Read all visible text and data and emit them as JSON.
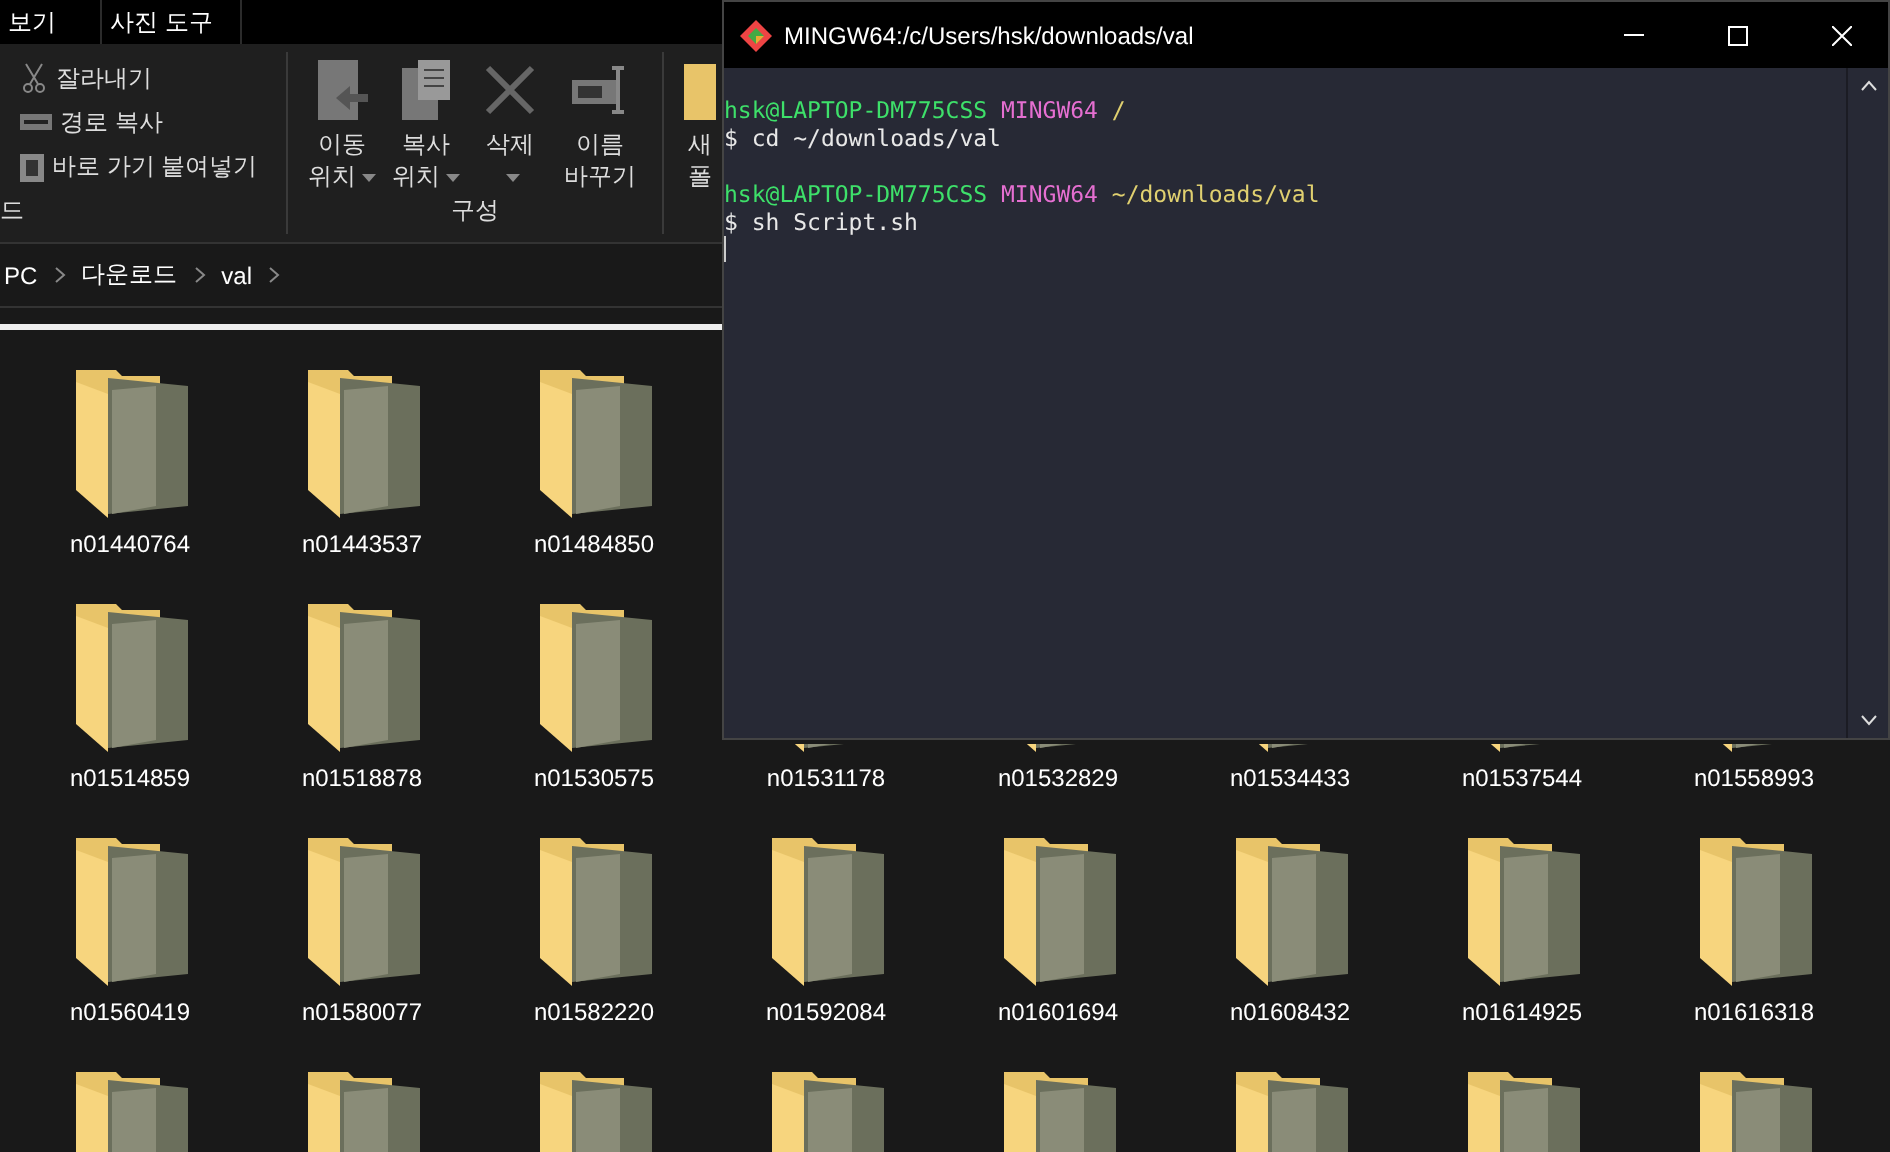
{
  "ribbon_tabs": [
    {
      "label": "보기",
      "selected": false
    },
    {
      "label": "사진 도구",
      "selected": false
    }
  ],
  "ribbon": {
    "clipboard_items": [
      {
        "label": "잘라내기",
        "kind": "cut"
      },
      {
        "label": "경로 복사",
        "kind": "path"
      },
      {
        "label": "바로 가기 붙여넣기",
        "kind": "shortcut"
      }
    ],
    "clipboard_group_label": "드",
    "organize_buttons": [
      {
        "line1": "이동",
        "line2": "위치",
        "kind": "move",
        "dropdown": true
      },
      {
        "line1": "복사",
        "line2": "위치",
        "kind": "copy",
        "dropdown": true
      },
      {
        "line1": "삭제",
        "kind": "delete",
        "dropdown": true
      },
      {
        "line1": "이름",
        "line2": "바꾸기",
        "kind": "rename",
        "dropdown": false
      }
    ],
    "organize_group_label": "구성",
    "new_folder": {
      "line1": "새",
      "line2": "폴"
    }
  },
  "breadcrumb": [
    "PC",
    "다운로드",
    "val"
  ],
  "folder_rows": [
    [
      {
        "name": "n01440764"
      },
      {
        "name": "n01443537"
      },
      {
        "name": "n01484850"
      }
    ],
    [
      {
        "name": "n01514859"
      },
      {
        "name": "n01518878"
      },
      {
        "name": "n01530575"
      },
      {
        "name": "n01531178",
        "covered": true
      },
      {
        "name": "n01532829",
        "covered": true
      },
      {
        "name": "n01534433",
        "covered": true
      },
      {
        "name": "n01537544",
        "covered": true
      },
      {
        "name": "n01558993",
        "covered": true
      }
    ],
    [
      {
        "name": "n01560419"
      },
      {
        "name": "n01580077"
      },
      {
        "name": "n01582220"
      },
      {
        "name": "n01592084"
      },
      {
        "name": "n01601694"
      },
      {
        "name": "n01608432"
      },
      {
        "name": "n01614925"
      },
      {
        "name": "n01616318"
      }
    ],
    [
      {
        "cut": true
      },
      {
        "cut": true
      },
      {
        "cut": true
      },
      {
        "cut": true
      },
      {
        "cut": true
      },
      {
        "cut": true
      },
      {
        "cut": true
      },
      {
        "cut": true
      }
    ]
  ],
  "terminal": {
    "title": "MINGW64:/c/Users/hsk/downloads/val",
    "prompts": [
      {
        "user": "hsk@LAPTOP-DM775CSS",
        "system": "MINGW64",
        "path": "/",
        "command": "$ cd ~/downloads/val"
      },
      {
        "user": "hsk@LAPTOP-DM775CSS",
        "system": "MINGW64",
        "path": "~/downloads/val",
        "command": "$ sh Script.sh"
      }
    ]
  }
}
